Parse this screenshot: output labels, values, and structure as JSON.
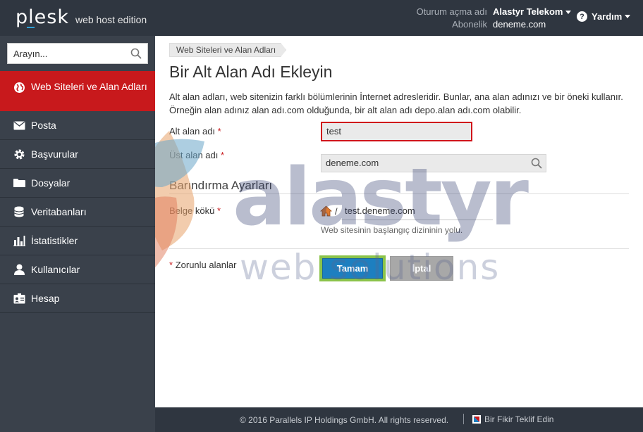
{
  "header": {
    "logo": "plesk",
    "logo_sub": "web host edition",
    "login_label": "Oturum açma adı",
    "login_value": "Alastyr Telekom",
    "subscriber_label": "Abonelik",
    "subscriber_value": "deneme.com",
    "help_label": "Yardım"
  },
  "sidebar": {
    "search_placeholder": "Arayın...",
    "items": [
      {
        "label": "Web Siteleri ve Alan Adları",
        "icon": "globe-icon",
        "active": true
      },
      {
        "label": "Posta",
        "icon": "mail-icon"
      },
      {
        "label": "Başvurular",
        "icon": "gear-icon"
      },
      {
        "label": "Dosyalar",
        "icon": "folder-icon"
      },
      {
        "label": "Veritabanları",
        "icon": "database-icon"
      },
      {
        "label": "İstatistikler",
        "icon": "bar-chart-icon"
      },
      {
        "label": "Kullanıcılar",
        "icon": "user-icon"
      },
      {
        "label": "Hesap",
        "icon": "account-card-icon"
      }
    ]
  },
  "main": {
    "breadcrumb": "Web Siteleri ve Alan Adları",
    "title": "Bir Alt Alan Adı Ekleyin",
    "intro": "Alt alan adları, web sitenizin farklı bölümlerinin İnternet adresleridir. Bunlar, ana alan adınızı ve bir öneki kullanır. Örneğin alan adınız alan adı.com olduğunda, bir alt alan adı depo.alan adı.com olabilir.",
    "subdomain_label": "Alt alan adı",
    "subdomain_value": "test",
    "parent_label": "Üst alan adı",
    "parent_value": "deneme.com",
    "hosting_section": "Barındırma Ayarları",
    "docroot_label": "Belge kökü",
    "docroot_slash": "/",
    "docroot_value": "test.deneme.com",
    "docroot_hint": "Web sitesinin başlangıç dizininin yolu.",
    "required_star": "*",
    "required_note": "Zorunlu alanlar",
    "ok_button": "Tamam",
    "cancel_button": "İptal"
  },
  "watermark": {
    "brand": "alastyr",
    "tagline": "web solutions"
  },
  "footer": {
    "copyright": "© 2016 Parallels IP Holdings GmbH. All rights reserved.",
    "feedback": "Bir Fikir Teklif Edin"
  },
  "colors": {
    "header_bg": "#2f3640",
    "sidebar_bg": "#3a414b",
    "active_item": "#c8191c",
    "primary_button": "#1d7fc0",
    "focus_border": "#d0151b",
    "highlight_green": "#8bc34a"
  }
}
